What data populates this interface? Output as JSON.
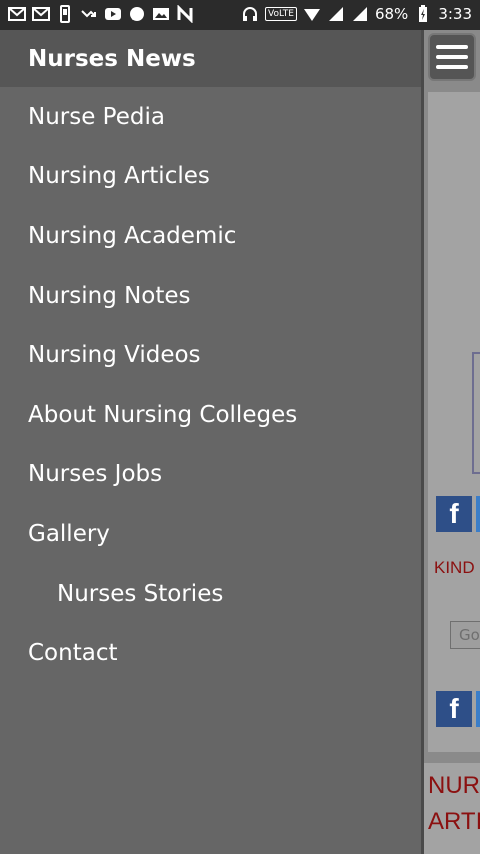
{
  "status_bar": {
    "battery": "68%",
    "time": "3:33",
    "network_badge": "VoLTE",
    "left_icons": [
      "gmail-icon",
      "gmail-icon",
      "phone-icon",
      "missed-call-icon",
      "youtube-icon",
      "chat-icon",
      "image-icon",
      "n-icon"
    ]
  },
  "drawer": {
    "title": "Nurses News",
    "items": [
      {
        "label": "Nurse Pedia",
        "sub": false
      },
      {
        "label": "Nursing Articles",
        "sub": false
      },
      {
        "label": "Nursing Academic",
        "sub": false
      },
      {
        "label": "Nursing Notes",
        "sub": false
      },
      {
        "label": "Nursing Videos",
        "sub": false
      },
      {
        "label": "About Nursing Colleges",
        "sub": false
      },
      {
        "label": "Nurses Jobs",
        "sub": false
      },
      {
        "label": "Gallery",
        "sub": false
      },
      {
        "label": "Nurses Stories",
        "sub": true
      },
      {
        "label": "Contact",
        "sub": false
      }
    ]
  },
  "page_peek": {
    "fb_letter": "f",
    "kind_text": "KIND",
    "search_text": "Go",
    "nur_line1": "NUR",
    "nur_line2": "ARTI"
  },
  "colors": {
    "drawer_bg": "#666666",
    "header_bg": "#565656",
    "status_bg": "#2b2b2b",
    "facebook_blue": "#2e4f88",
    "accent_red": "#8b1010"
  }
}
